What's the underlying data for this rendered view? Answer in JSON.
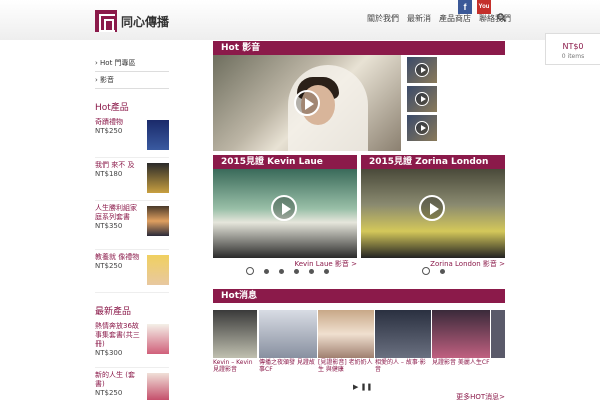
{
  "header": {
    "logo_text": "同心傳播",
    "nav": [
      "關於我們",
      "最新消",
      "產品商店",
      "聯絡我們"
    ],
    "facebook": "f",
    "youtube": "You"
  },
  "cart": {
    "total": "NT$0",
    "items": "0 items"
  },
  "sidebar": {
    "links": [
      "Hot 門專區",
      "影音"
    ],
    "hot_title": "Hot產品",
    "hot_products": [
      {
        "name": "奇蹟禮物",
        "price": "NT$250"
      },
      {
        "name": "我們 來不 及",
        "price": "NT$180"
      },
      {
        "name": "人生勝利組家庭系列套書",
        "price": "NT$350"
      },
      {
        "name": "教養就 像禮物",
        "price": "NT$250"
      }
    ],
    "new_title": "最新產品",
    "new_products": [
      {
        "name": "熱情奔放36故事集套書(共三冊)",
        "price": "NT$300"
      },
      {
        "name": "新的人生 (套書)",
        "price": "NT$250"
      }
    ]
  },
  "main": {
    "hot_video_title": "Hot 影音",
    "kevin_title": "2015見證 Kevin Laue",
    "kevin_link": "Kevin Laue 影音 >",
    "zorina_title": "2015見證 Zorina London",
    "zorina_link": "Zorina London 影音 >",
    "hotnews_title": "Hot消息",
    "hotnews_caps": [
      "Kevin – Kevin見證影音",
      "傳播之夜頒發 見證故事CF",
      "[見證影音] 老奶奶人生 與健康",
      "相愛的人 – 故事·影音",
      "見證影音 美麗人生CF"
    ],
    "more_link": "更多HOT消息>"
  },
  "colors": {
    "accent": "#8b1a4a"
  }
}
